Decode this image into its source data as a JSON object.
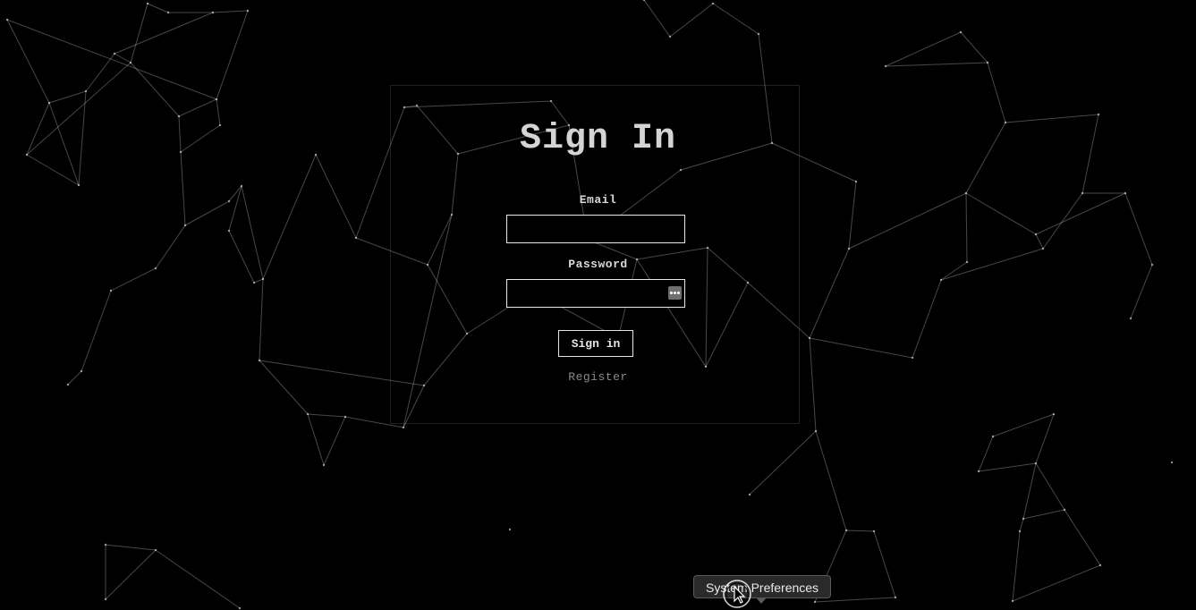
{
  "page": {
    "title": "Sign In"
  },
  "form": {
    "email_label": "Email",
    "email_value": "",
    "password_label": "Password",
    "password_value": "",
    "password_key_icon": "password-manager-key-icon",
    "submit_label": "Sign in",
    "register_label": "Register"
  },
  "dock": {
    "tooltip": "System Preferences"
  },
  "theme": {
    "background": "#000000",
    "foreground": "#d4d4d4",
    "network_lines": "#ffffff"
  }
}
